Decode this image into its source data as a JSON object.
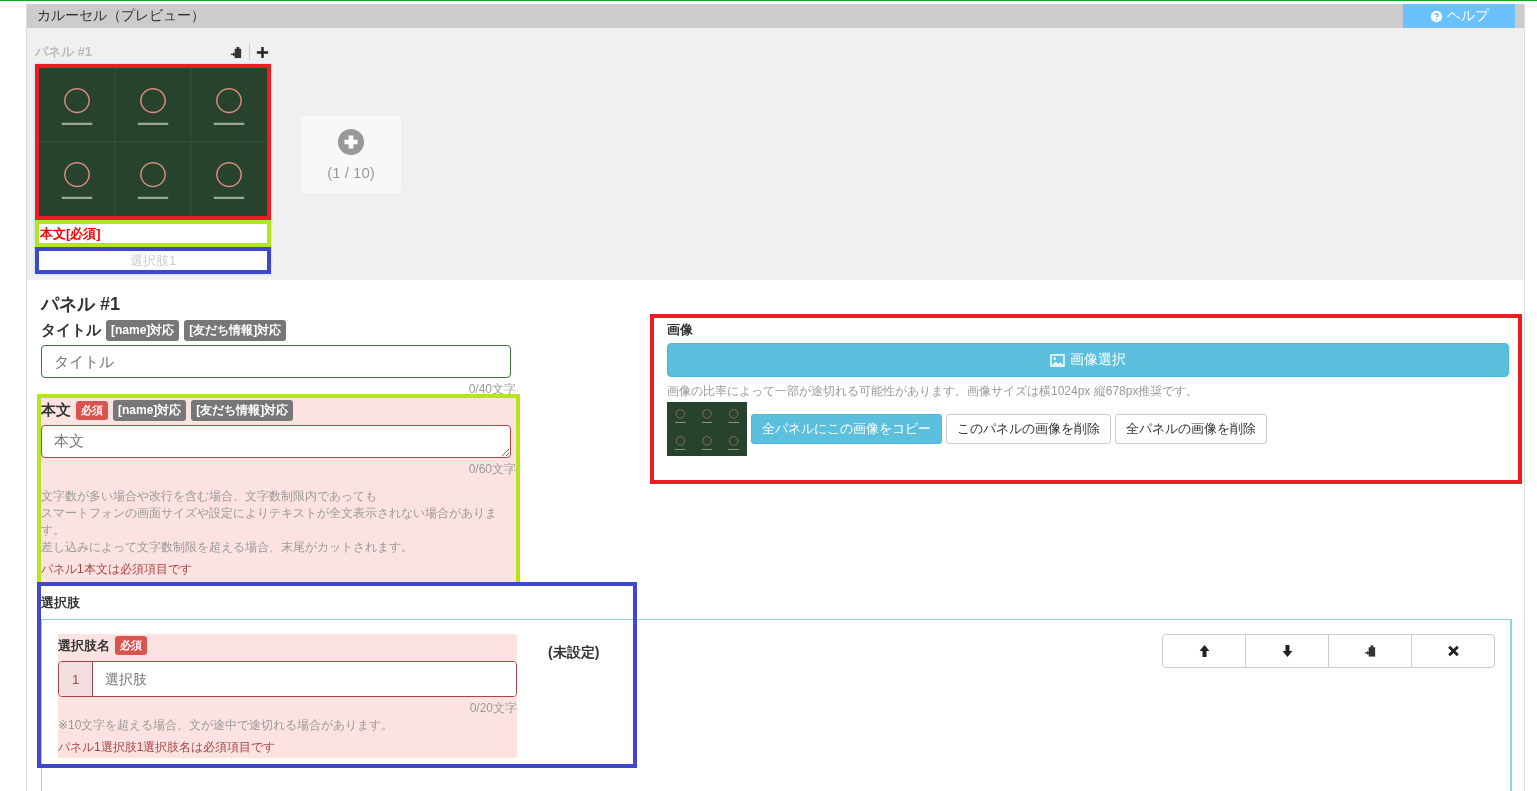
{
  "header": {
    "title": "カルーセル（プレビュー）",
    "help_button": "ヘルプ"
  },
  "preview": {
    "panels": [
      {
        "label": "パネル #1",
        "body_text": "本文[必須]",
        "choice": "選択肢1"
      }
    ],
    "add_card": {
      "counter": "(1 / 10)"
    }
  },
  "editor": {
    "heading": "パネル #1",
    "title_field": {
      "label": "タイトル",
      "tags": [
        "[name]対応",
        "[友だち情報]対応"
      ],
      "placeholder": "タイトル",
      "counter": "0/40文字"
    },
    "body_field": {
      "label": "本文",
      "required_badge": "必須",
      "tags": [
        "[name]対応",
        "[友だち情報]対応"
      ],
      "placeholder": "本文",
      "counter": "0/60文字",
      "notes": [
        "文字数が多い場合や改行を含む場合、文字数制限内であっても",
        "スマートフォンの画面サイズや設定によりテキストが全文表示されない場合があります。",
        "差し込みによって文字数制限を超える場合、末尾がカットされます。"
      ],
      "error": "パネル1本文は必須項目です"
    },
    "image": {
      "label": "画像",
      "select_button": "画像選択",
      "note": "画像の比率によって一部が途切れる可能性があります。画像サイズは横1024px 縦678px推奨です。",
      "buttons": [
        {
          "label": "全パネルにこの画像をコピー",
          "kind": "primary"
        },
        {
          "label": "このパネルの画像を削除",
          "kind": "default"
        },
        {
          "label": "全パネルの画像を削除",
          "kind": "default"
        }
      ]
    },
    "choices": {
      "label": "選択肢",
      "items": [
        {
          "name_label": "選択肢名",
          "required_badge": "必須",
          "index": "1",
          "placeholder": "選択肢",
          "counter": "0/20文字",
          "note": "※10文字を超える場合、文が途中で途切れる場合があります。",
          "error": "パネル1選択肢1選択肢名は必須項目です",
          "action": "(未設定)"
        }
      ]
    }
  }
}
